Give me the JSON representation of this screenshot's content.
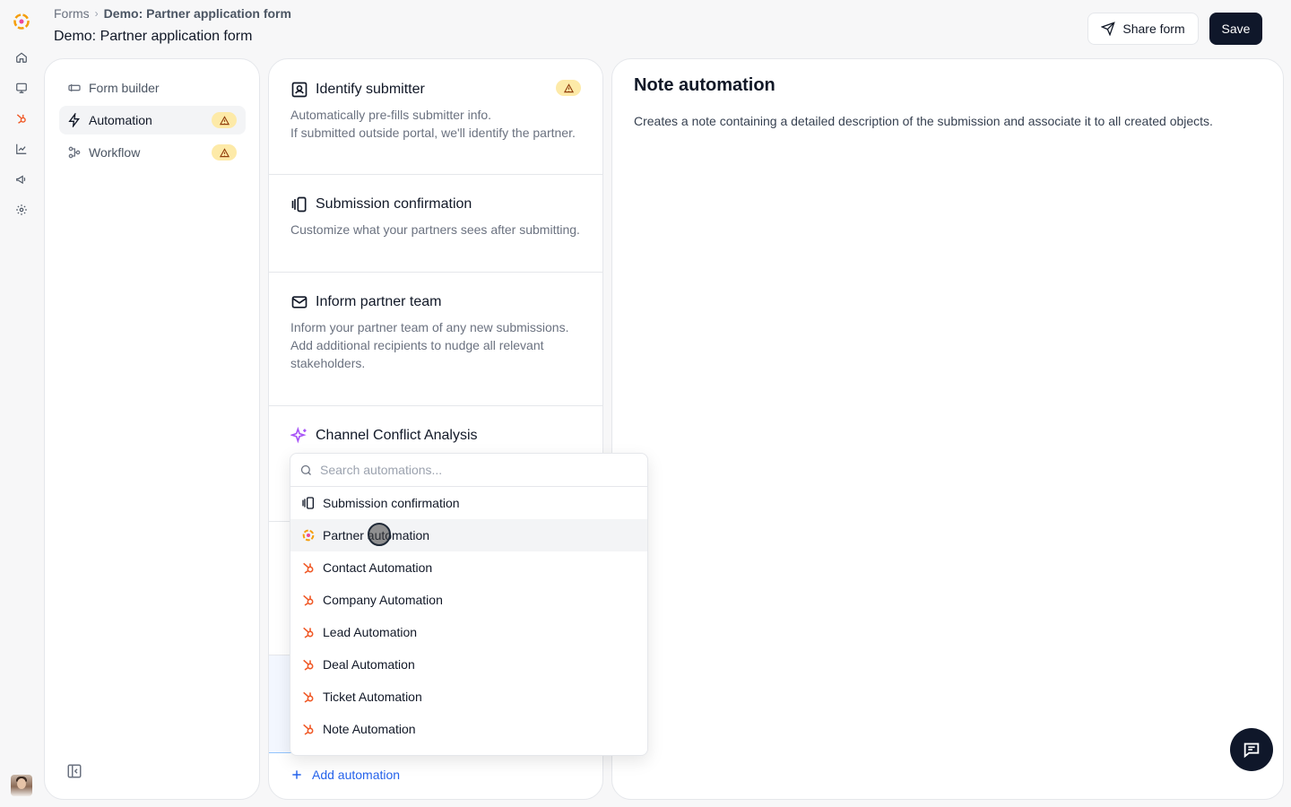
{
  "rail": {
    "items": [
      "logo-icon",
      "home-icon",
      "monitor-icon",
      "hubspot-icon",
      "chart-icon",
      "megaphone-icon",
      "settings-icon"
    ]
  },
  "breadcrumb": {
    "root": "Forms",
    "current": "Demo: Partner application form"
  },
  "page_title": "Demo: Partner application form",
  "header": {
    "share_label": "Share form",
    "save_label": "Save"
  },
  "nav": {
    "items": [
      {
        "label": "Form builder",
        "icon": "form-builder-icon",
        "warning": false
      },
      {
        "label": "Automation",
        "icon": "lightning-icon",
        "warning": true
      },
      {
        "label": "Workflow",
        "icon": "workflow-icon",
        "warning": true
      }
    ]
  },
  "automations": [
    {
      "title": "Identify submitter",
      "desc": "Automatically pre-fills submitter info.\nIf submitted outside portal, we'll identify the partner.",
      "warning": true
    },
    {
      "title": "Submission confirmation",
      "desc": "Customize what your partners sees after submitting."
    },
    {
      "title": "Inform partner team",
      "desc": "Inform your partner team of any new submissions.\nAdd additional recipients to nudge all relevant stakeholders."
    },
    {
      "title": "Channel Conflict Analysis",
      "desc": ""
    }
  ],
  "add_automation": "Add automation",
  "detail": {
    "title": "Note automation",
    "description": "Creates a note containing a detailed description of the submission and associate it to all created objects."
  },
  "dropdown": {
    "search_placeholder": "Search automations...",
    "items": [
      {
        "label": "Submission confirmation",
        "icon": "confirmation-icon"
      },
      {
        "label": "Partner automation",
        "icon": "partner-logo-icon"
      },
      {
        "label": "Contact Automation",
        "icon": "hubspot-icon"
      },
      {
        "label": "Company Automation",
        "icon": "hubspot-icon"
      },
      {
        "label": "Lead Automation",
        "icon": "hubspot-icon"
      },
      {
        "label": "Deal Automation",
        "icon": "hubspot-icon"
      },
      {
        "label": "Ticket Automation",
        "icon": "hubspot-icon"
      },
      {
        "label": "Note Automation",
        "icon": "hubspot-icon"
      }
    ]
  },
  "colors": {
    "accent": "#2563eb",
    "primary_button": "#0f172a",
    "warning": "#fdeaa8",
    "hubspot": "#f05a28"
  }
}
